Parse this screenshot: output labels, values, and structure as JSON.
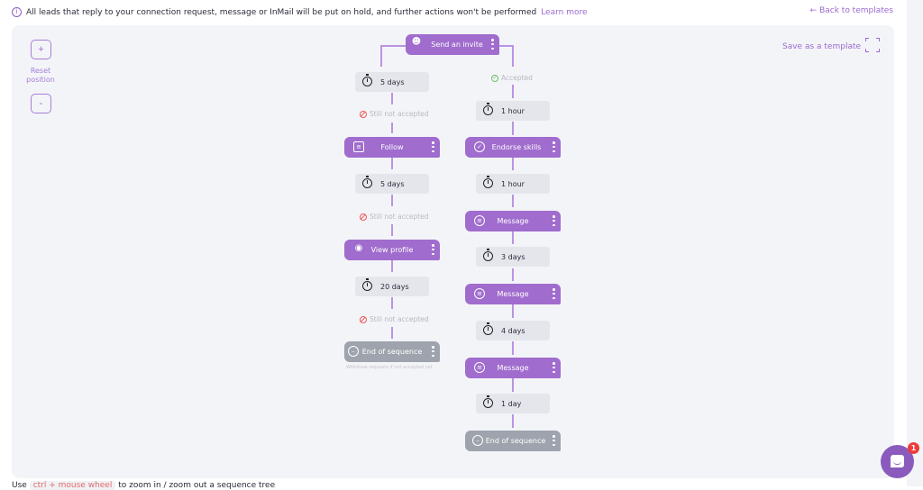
{
  "notice": {
    "icon": "info-icon",
    "text": "All leads that reply to your connection request, message or InMail will be put on hold, and further actions won't be performed",
    "link": "Learn more"
  },
  "back_link": "← Back to templates",
  "canvas": {
    "zoom_in": "+",
    "zoom_out": "-",
    "reset_label": "Reset position",
    "save_template": "Save as a template",
    "fullscreen_icon": "fullscreen-icon"
  },
  "sequence": {
    "root": {
      "label": "Send an invite",
      "icon": "user-icon"
    },
    "left_branch": {
      "condition": "Still not accepted",
      "steps": [
        {
          "type": "delay",
          "label": "5 days"
        },
        {
          "type": "condition",
          "label": "Still not accepted"
        },
        {
          "type": "action",
          "label": "Follow",
          "icon": "follow-icon"
        },
        {
          "type": "delay",
          "label": "5 days"
        },
        {
          "type": "condition",
          "label": "Still not accepted"
        },
        {
          "type": "action",
          "label": "View profile",
          "icon": "eye-icon"
        },
        {
          "type": "delay",
          "label": "20 days"
        },
        {
          "type": "condition",
          "label": "Still not accepted"
        },
        {
          "type": "end",
          "label": "End of sequence",
          "note": "Withdraw requests if not accepted yet"
        }
      ]
    },
    "right_branch": {
      "condition": "Accepted",
      "steps": [
        {
          "type": "condition",
          "label": "Accepted"
        },
        {
          "type": "delay",
          "label": "1 hour"
        },
        {
          "type": "action",
          "label": "Endorse skills",
          "icon": "check-circle-icon"
        },
        {
          "type": "delay",
          "label": "1 hour"
        },
        {
          "type": "action",
          "label": "Message",
          "icon": "message-icon"
        },
        {
          "type": "delay",
          "label": "3 days"
        },
        {
          "type": "action",
          "label": "Message",
          "icon": "message-icon"
        },
        {
          "type": "delay",
          "label": "4 days"
        },
        {
          "type": "action",
          "label": "Message",
          "icon": "message-icon"
        },
        {
          "type": "delay",
          "label": "1 day"
        },
        {
          "type": "end",
          "label": "End of sequence"
        }
      ]
    }
  },
  "footer": {
    "prefix": "Use",
    "shortcut": "ctrl + mouse wheel",
    "suffix": "to zoom in / zoom out a sequence tree"
  },
  "chat": {
    "badge_count": "1"
  }
}
